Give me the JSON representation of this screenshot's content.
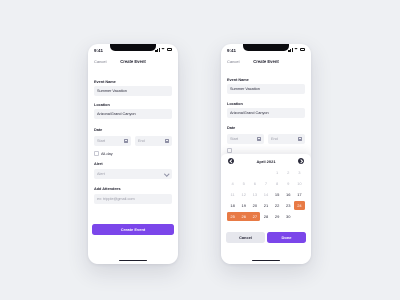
{
  "status": {
    "time": "9:41"
  },
  "screen1": {
    "nav": {
      "cancel": "Cancel",
      "title": "Create Event"
    },
    "event_name": {
      "label": "Event Name",
      "value": "Summer Vacation"
    },
    "location": {
      "label": "Location",
      "value": "Arizona/Grand Canyon"
    },
    "date": {
      "label": "Date",
      "start_placeholder": "Start",
      "end_placeholder": "End",
      "allday_label": "All-day"
    },
    "alert": {
      "label": "Alert",
      "placeholder": "Alert"
    },
    "attendees": {
      "label": "Add Attendees",
      "placeholder": "ex: tripple@gmail.com"
    },
    "submit": "Create Event"
  },
  "screen2": {
    "nav": {
      "cancel": "Cancel",
      "title": "Create Event"
    },
    "event_name": {
      "label": "Event Name",
      "value": "Summer Vacation"
    },
    "location": {
      "label": "Location",
      "value": "Arizona/Grand Canyon"
    },
    "date": {
      "label": "Date",
      "start_placeholder": "Start",
      "end_placeholder": "End"
    },
    "calendar": {
      "month": "April 2021",
      "rows": [
        [
          {
            "d": "",
            "s": "none"
          },
          {
            "d": "",
            "s": "none"
          },
          {
            "d": "",
            "s": "none"
          },
          {
            "d": "",
            "s": "none"
          },
          {
            "d": "1",
            "s": "muted"
          },
          {
            "d": "2",
            "s": "muted"
          },
          {
            "d": "3",
            "s": "muted"
          }
        ],
        [
          {
            "d": "4",
            "s": "muted"
          },
          {
            "d": "5",
            "s": "muted"
          },
          {
            "d": "6",
            "s": "muted"
          },
          {
            "d": "7",
            "s": "muted"
          },
          {
            "d": "8",
            "s": "muted"
          },
          {
            "d": "9",
            "s": "muted"
          },
          {
            "d": "10",
            "s": "muted"
          }
        ],
        [
          {
            "d": "11",
            "s": "muted"
          },
          {
            "d": "12",
            "s": "muted"
          },
          {
            "d": "13",
            "s": "muted"
          },
          {
            "d": "14",
            "s": "muted"
          },
          {
            "d": "15",
            "s": "normal"
          },
          {
            "d": "16",
            "s": "normal"
          },
          {
            "d": "17",
            "s": "normal"
          }
        ],
        [
          {
            "d": "18",
            "s": "normal"
          },
          {
            "d": "19",
            "s": "normal"
          },
          {
            "d": "20",
            "s": "normal"
          },
          {
            "d": "21",
            "s": "normal"
          },
          {
            "d": "22",
            "s": "normal"
          },
          {
            "d": "23",
            "s": "normal"
          },
          {
            "d": "24",
            "s": "sel-single"
          }
        ],
        [
          {
            "d": "25",
            "s": "sel-start"
          },
          {
            "d": "26",
            "s": "sel"
          },
          {
            "d": "27",
            "s": "sel-end"
          },
          {
            "d": "28",
            "s": "normal"
          },
          {
            "d": "29",
            "s": "normal"
          },
          {
            "d": "30",
            "s": "normal"
          },
          {
            "d": "",
            "s": "none"
          }
        ]
      ]
    },
    "cancel_button": "Cancel",
    "done_button": "Done"
  },
  "colors": {
    "accent": "#7b46ea",
    "selection": "#e87a45",
    "background": "#eef0f3"
  }
}
